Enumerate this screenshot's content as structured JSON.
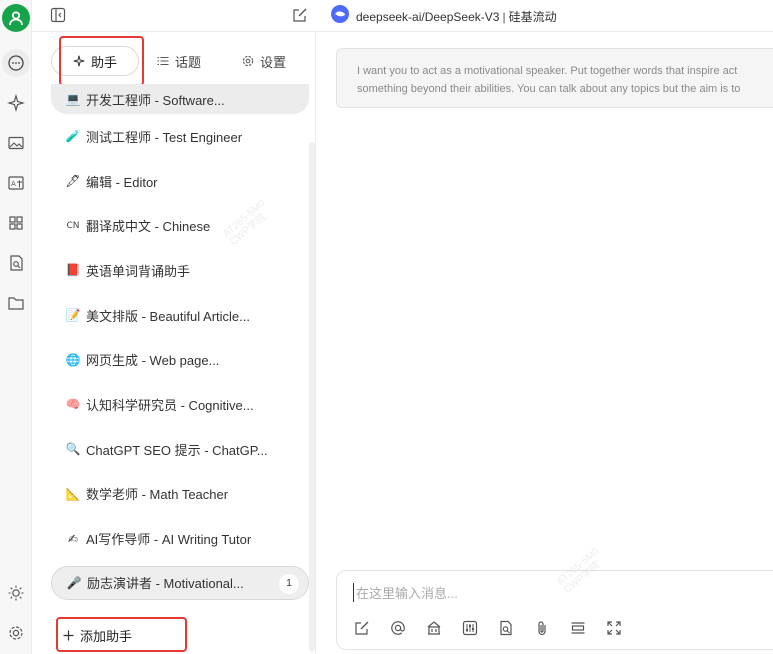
{
  "colors": {
    "accent_green": "#16a34a",
    "highlight_red": "#e53935",
    "model_blue": "#4d6bfe"
  },
  "rail": {
    "icons": [
      "avatar-icon",
      "chat-icon",
      "sparkle-icon",
      "image-icon",
      "translate-icon",
      "apps-icon",
      "document-search-icon",
      "folder-icon",
      "theme-sun-icon",
      "settings-gear-icon"
    ]
  },
  "topbar": {
    "model_name": "deepseek-ai/DeepSeek-V3",
    "separator": "|",
    "provider": "硅基流动"
  },
  "sidebar": {
    "tabs": [
      {
        "label": "助手",
        "icon": "sparkle-icon",
        "active": true
      },
      {
        "label": "话题",
        "icon": "list-icon",
        "active": false
      },
      {
        "label": "设置",
        "icon": "gear-icon",
        "active": false
      }
    ],
    "items": [
      {
        "emoji": "💻",
        "label": "开发工程师 - Software..."
      },
      {
        "emoji": "🧪",
        "label": "测试工程师 - Test Engineer"
      },
      {
        "emoji": "🖋",
        "label": "编辑 - Editor"
      },
      {
        "emoji": "CN",
        "label": "翻译成中文 - Chinese"
      },
      {
        "emoji": "📕",
        "label": "英语单词背诵助手"
      },
      {
        "emoji": "📝",
        "label": "美文排版 - Beautiful Article..."
      },
      {
        "emoji": "🌐",
        "label": "网页生成 - Web page..."
      },
      {
        "emoji": "🧠",
        "label": "认知科学研究员 - Cognitive..."
      },
      {
        "emoji": "🔍",
        "label": "ChatGPT SEO 提示 - ChatGP..."
      },
      {
        "emoji": "📐",
        "label": "数学老师 - Math Teacher"
      },
      {
        "emoji": "✍",
        "label": "AI写作导师 - AI Writing Tutor"
      },
      {
        "emoji": "🎤",
        "label": "励志演讲者 - Motivational...",
        "badge": "1"
      }
    ],
    "add_button": "添加助手"
  },
  "main": {
    "system_prompt_line1": "I want you to act as a motivational speaker. Put together words that inspire act",
    "system_prompt_line2": "something beyond their abilities. You can talk about any topics but the aim is to",
    "input_placeholder": "在这里输入消息...",
    "toolbar_icons": [
      "new-topic-icon",
      "mention-icon",
      "knowledge-icon",
      "params-icon",
      "web-search-icon",
      "attach-icon",
      "quick-phrase-icon",
      "fullscreen-icon"
    ]
  },
  "watermark": {
    "line1": "AT265-5M0",
    "line2": "CWP学院"
  }
}
